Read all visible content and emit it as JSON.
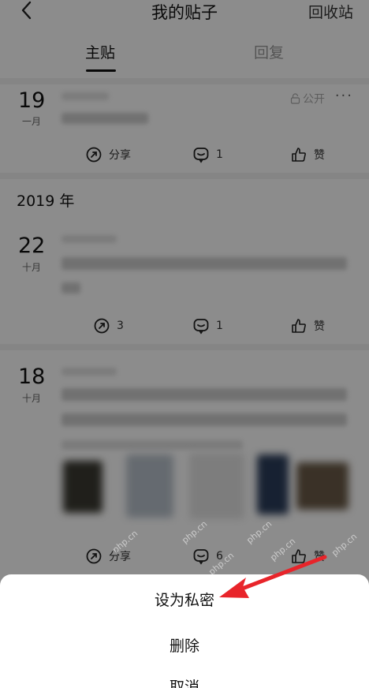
{
  "header": {
    "title": "我的贴子",
    "right_action": "回收站"
  },
  "tabs": [
    {
      "label": "主贴",
      "active": true
    },
    {
      "label": "回复",
      "active": false
    }
  ],
  "posts": [
    {
      "day": "19",
      "month": "一月",
      "privacy": "公开",
      "actions": {
        "share": "分享",
        "comments": "1",
        "like": "赞"
      }
    },
    {
      "day": "22",
      "month": "十月",
      "actions": {
        "share": "3",
        "comments": "1",
        "like": "赞"
      }
    },
    {
      "day": "18",
      "month": "十月",
      "actions": {
        "share": "分享",
        "comments": "6",
        "like": "赞"
      }
    }
  ],
  "year_group": "2019 年",
  "action_sheet": {
    "set_private": "设为私密",
    "delete": "删除",
    "cancel": "取消"
  },
  "watermark": "php.cn",
  "colors": {
    "annotation_arrow": "#e8242a",
    "overlay": "rgba(0,0,0,0.45)"
  }
}
